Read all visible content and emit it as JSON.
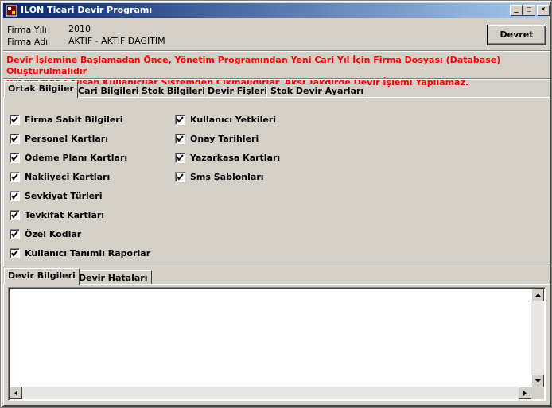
{
  "window": {
    "title": "ILON Ticari Devir Programı",
    "controls": {
      "minimize": "_",
      "maximize": "□",
      "close": "×"
    }
  },
  "info": {
    "year_label": "Firma Yılı",
    "year_value": "2010",
    "name_label": "Firma Adı",
    "name_value": "AKTIF - AKTIF DAGITIM"
  },
  "toolbar": {
    "devret_label": "Devret"
  },
  "warning": {
    "line1": "Devir İşlemine Başlamadan Önce, Yönetim Programından Yeni Cari Yıl İçin Firma Dosyası (Database) Oluşturulmalıdır",
    "line2": "Programda Çalışan Kullanıcılar Sistemden Çıkmalıdırlar. Aksi Takdirde Devir İşlemi Yapılamaz."
  },
  "top_tabs": [
    {
      "label": "Ortak Bilgiler",
      "active": true
    },
    {
      "label": "Cari Bilgileri",
      "active": false
    },
    {
      "label": "Stok Bilgileri",
      "active": false
    },
    {
      "label": "Devir Fişleri",
      "active": false
    },
    {
      "label": "Stok Devir Ayarları",
      "active": false
    }
  ],
  "checkboxes_left": [
    {
      "label": "Firma Sabit Bilgileri",
      "checked": true
    },
    {
      "label": "Personel Kartları",
      "checked": true
    },
    {
      "label": "Ödeme Planı Kartları",
      "checked": true
    },
    {
      "label": "Nakliyeci Kartları",
      "checked": true
    },
    {
      "label": "Sevkiyat Türleri",
      "checked": true
    },
    {
      "label": "Tevkifat Kartları",
      "checked": true
    },
    {
      "label": "Özel Kodlar",
      "checked": true
    },
    {
      "label": "Kullanıcı Tanımlı Raporlar",
      "checked": true
    }
  ],
  "checkboxes_right": [
    {
      "label": "Kullanıcı Yetkileri",
      "checked": true
    },
    {
      "label": "Onay Tarihleri",
      "checked": true
    },
    {
      "label": "Yazarkasa Kartları",
      "checked": true
    },
    {
      "label": "Sms Şablonları",
      "checked": true
    }
  ],
  "bottom_tabs": [
    {
      "label": "Devir Bilgileri",
      "active": true
    },
    {
      "label": "Devir Hataları",
      "active": false
    }
  ],
  "log": {
    "value": ""
  },
  "colors": {
    "title_start": "#0a246a",
    "title_end": "#a6caf0",
    "warning": "#ff0000",
    "face": "#d4d0c8"
  }
}
